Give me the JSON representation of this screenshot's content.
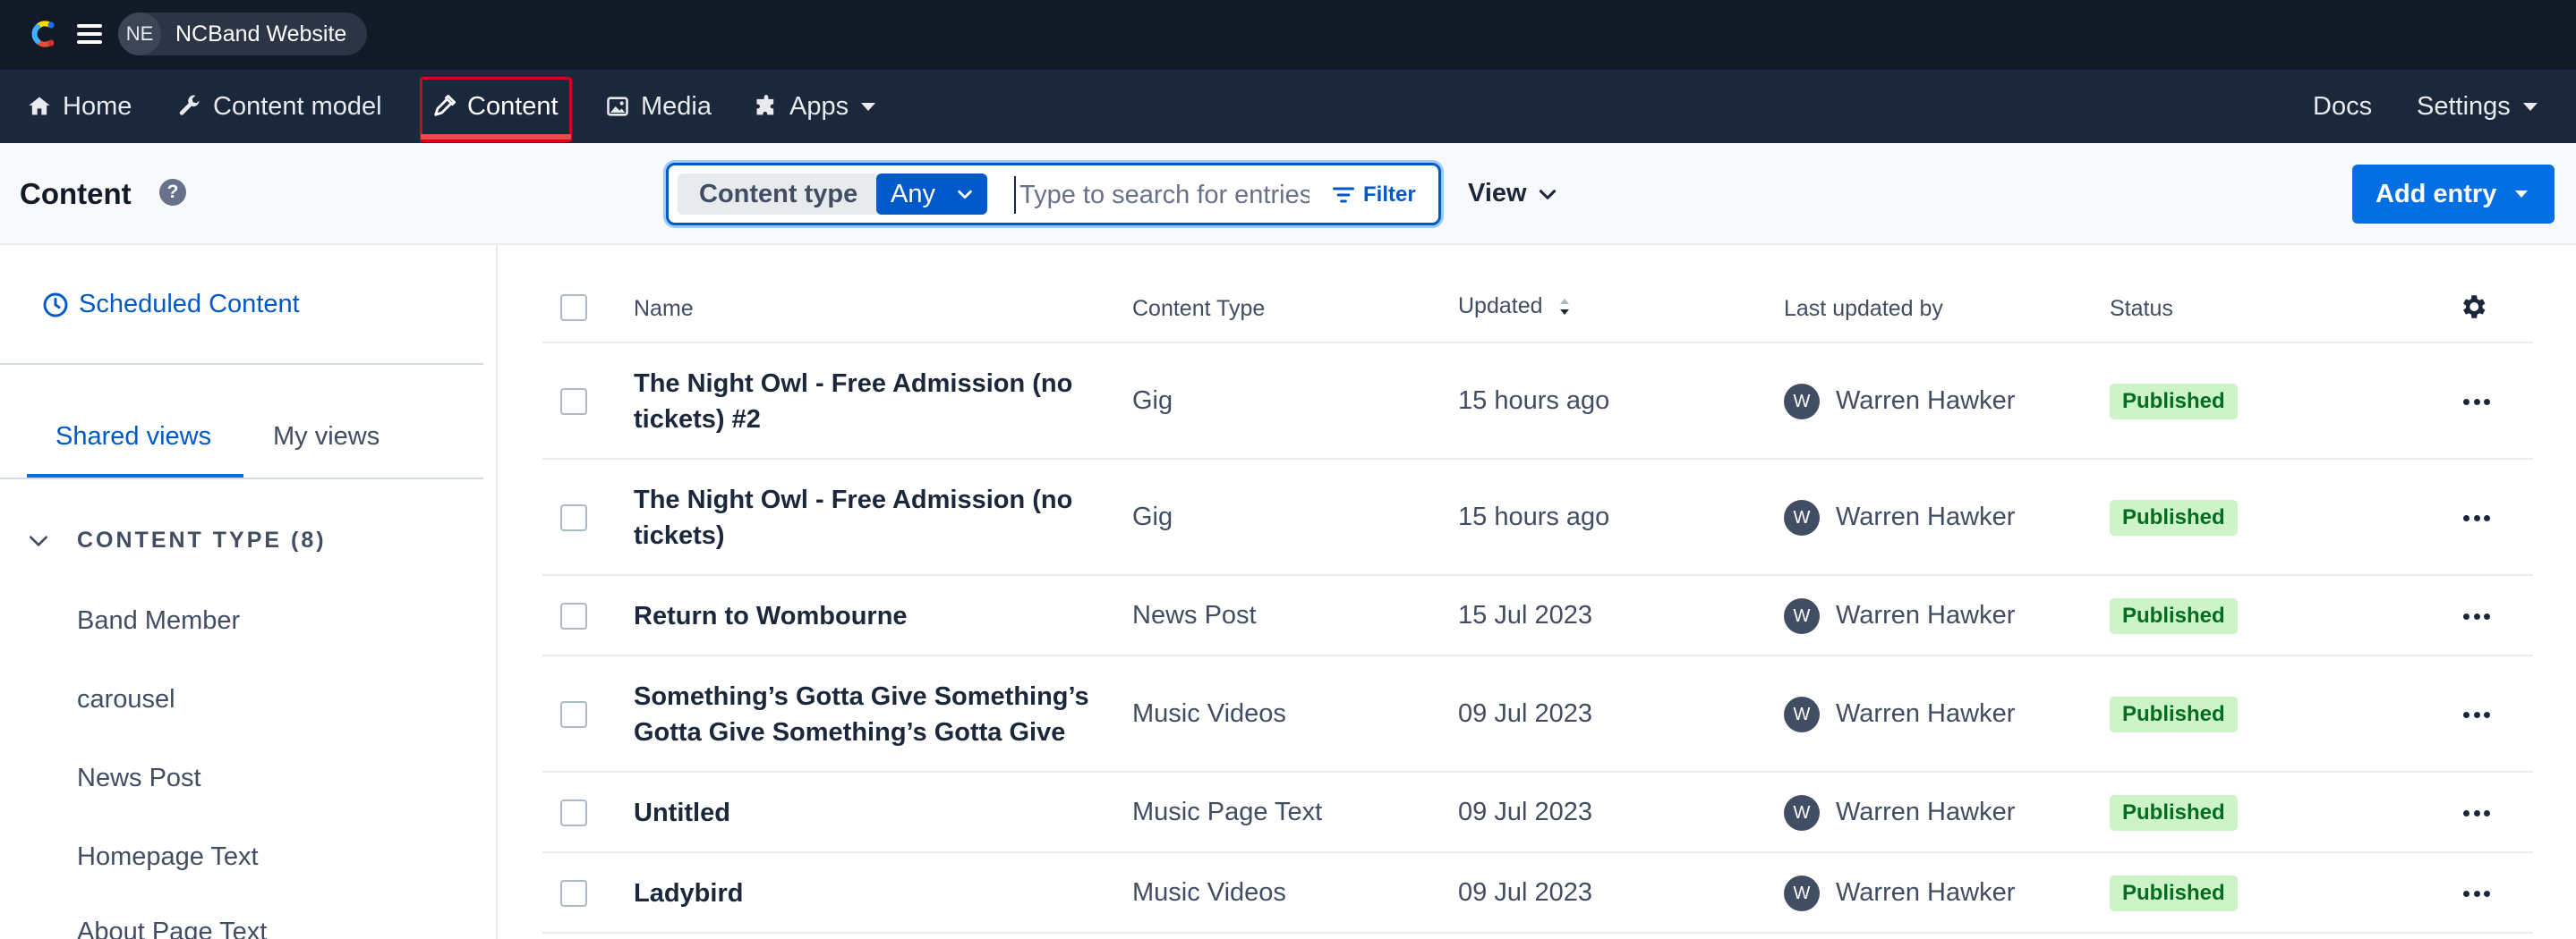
{
  "topbar": {
    "space_initials": "NE",
    "space_name": "NCBand Website"
  },
  "nav": {
    "items": [
      {
        "label": "Home",
        "icon": "home-icon"
      },
      {
        "label": "Content model",
        "icon": "wrench-icon"
      },
      {
        "label": "Content",
        "icon": "pen-icon",
        "active": true
      },
      {
        "label": "Media",
        "icon": "image-icon"
      },
      {
        "label": "Apps",
        "icon": "puzzle-icon"
      }
    ],
    "docs": "Docs",
    "settings": "Settings"
  },
  "toolbar": {
    "title": "Content",
    "help": "?",
    "content_type_label": "Content type",
    "content_type_value": "Any",
    "search_placeholder": "Type to search for entries",
    "filter_label": "Filter",
    "view_label": "View",
    "add_entry_label": "Add entry"
  },
  "sidebar": {
    "scheduled": "Scheduled Content",
    "tab_shared": "Shared views",
    "tab_mine": "My views",
    "content_type_header": "CONTENT TYPE (8)",
    "content_types": [
      "Band Member",
      "carousel",
      "News Post",
      "Homepage Text",
      "About Page Text"
    ]
  },
  "table": {
    "columns": [
      "Name",
      "Content Type",
      "Updated",
      "Last updated by",
      "Status"
    ],
    "rows": [
      {
        "name": "The Night Owl - Free Admission (no tickets) #2",
        "type": "Gig",
        "updated": "15 hours ago",
        "avatar": "W",
        "user": "Warren Hawker",
        "status": "Published"
      },
      {
        "name": "The Night Owl - Free Admission (no tickets)",
        "type": "Gig",
        "updated": "15 hours ago",
        "avatar": "W",
        "user": "Warren Hawker",
        "status": "Published"
      },
      {
        "name": "Return to Wombourne",
        "type": "News Post",
        "updated": "15 Jul 2023",
        "avatar": "W",
        "user": "Warren Hawker",
        "status": "Published"
      },
      {
        "name": "Something’s Gotta Give Something’s Gotta Give Something’s Gotta Give",
        "type": "Music Videos",
        "updated": "09 Jul 2023",
        "avatar": "W",
        "user": "Warren Hawker",
        "status": "Published"
      },
      {
        "name": "Untitled",
        "type": "Music Page Text",
        "updated": "09 Jul 2023",
        "avatar": "W",
        "user": "Warren Hawker",
        "status": "Published"
      },
      {
        "name": "Ladybird",
        "type": "Music Videos",
        "updated": "09 Jul 2023",
        "avatar": "W",
        "user": "Warren Hawker",
        "status": "Published"
      }
    ]
  },
  "colors": {
    "topbar_bg": "#111a26",
    "navbar_bg": "#1b273a",
    "primary": "#036fe3",
    "active_highlight": "#d0021b",
    "published_bg": "#cdf3c6",
    "published_text": "#006d23"
  }
}
